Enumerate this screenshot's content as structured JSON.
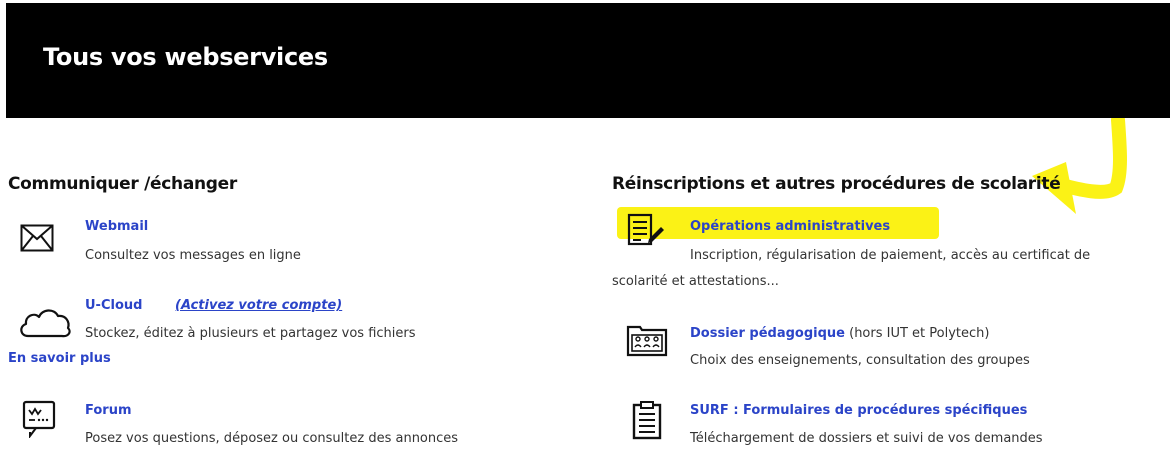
{
  "header": {
    "title": "Tous vos webservices"
  },
  "colors": {
    "banner_bg": "#000000",
    "link": "#2b44c8",
    "highlight": "#fbf216"
  },
  "left_column": {
    "title": "Communiquer /échanger",
    "services": [
      {
        "icon": "envelope-icon",
        "name": "Webmail",
        "description": "Consultez vos messages en ligne"
      },
      {
        "icon": "cloud-icon",
        "name": "U-Cloud",
        "extra_link": "(Activez votre compte)",
        "description": "Stockez, éditez à plusieurs et partagez vos fichiers",
        "more_link": "En savoir plus"
      },
      {
        "icon": "forum-icon",
        "name": "Forum",
        "description": "Posez vos questions, déposez ou consultez des annonces"
      }
    ]
  },
  "right_column": {
    "title": "Réinscriptions et autres procédures de scolarité",
    "services": [
      {
        "icon": "document-edit-icon",
        "name": "Opérations administratives",
        "description_line1": "Inscription, régularisation de paiement, accès au certificat de",
        "description_line2": "scolarité et attestations..."
      },
      {
        "icon": "classroom-folder-icon",
        "name": "Dossier pédagogique",
        "name_suffix": " (hors IUT et Polytech)",
        "description": "Choix des enseignements, consultation des groupes"
      },
      {
        "icon": "clipboard-icon",
        "name": "SURF : Formulaires de procédures spécifiques",
        "description": "Téléchargement de dossiers et suivi de vos demandes"
      }
    ]
  }
}
